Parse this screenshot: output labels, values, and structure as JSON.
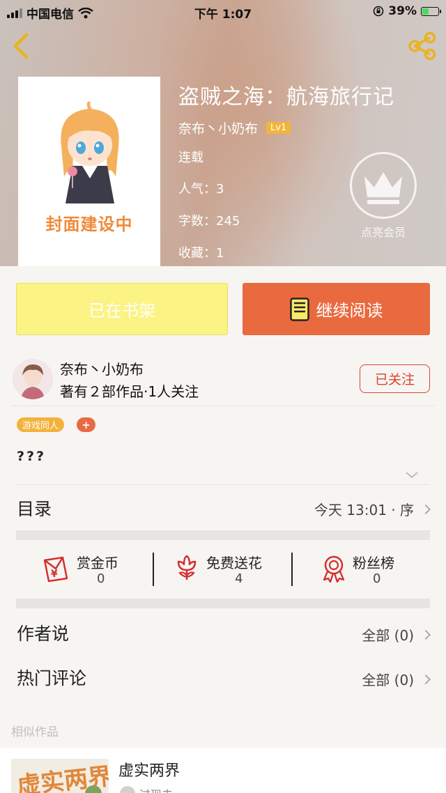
{
  "status_bar": {
    "carrier": "中国电信",
    "time": "下午 1:07",
    "battery": "39%"
  },
  "book": {
    "title": "盗贼之海：航海旅行记",
    "author": "奈布丶小奶布",
    "level": "Lv1",
    "status": "连载",
    "popularity": "人气：3",
    "word_count": "字数：245",
    "favorites": "收藏：1",
    "cover_text": "封面建设中",
    "vip_label": "点亮会员"
  },
  "actions": {
    "shelf": "已在书架",
    "read": "继续阅读"
  },
  "author_section": {
    "name": "奈布丶小奶布",
    "works": "著有２部作品·1人关注",
    "follow": "已关注"
  },
  "tags": [
    "游戏同人"
  ],
  "tag_add": "+",
  "description": "???",
  "catalog": {
    "label": "目录",
    "latest": "今天 13:01 · 序"
  },
  "stats": [
    {
      "icon": "gold-coin-envelope-icon",
      "label": "赏金币",
      "value": "0"
    },
    {
      "icon": "flower-icon",
      "label": "免费送花",
      "value": "4"
    },
    {
      "icon": "medal-icon",
      "label": "粉丝榜",
      "value": "0"
    }
  ],
  "author_says": {
    "label": "作者说",
    "link": "全部 (0)"
  },
  "hot_comments": {
    "label": "热门评论",
    "link": "全部 (0)"
  },
  "similar": {
    "section_label": "相似作品",
    "items": [
      {
        "title": "虚实两界",
        "author": "过现未"
      }
    ]
  },
  "colors": {
    "accent_orange": "#e96a3f",
    "shelf_yellow": "#fbf383",
    "follow_red": "#d9432f",
    "tag_yellow": "#f4b23c"
  }
}
